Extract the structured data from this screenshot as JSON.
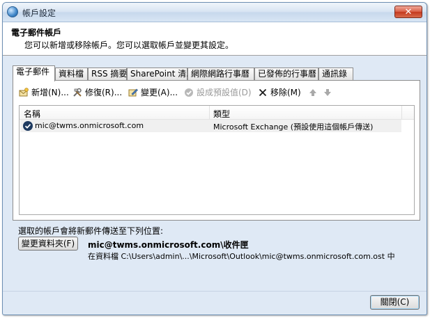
{
  "window": {
    "title": "帳戶設定",
    "close_label": "✕"
  },
  "header": {
    "title": "電子郵件帳戶",
    "description": "您可以新增或移除帳戶。您可以選取帳戶並變更其設定。"
  },
  "tabs": [
    {
      "label": "電子郵件",
      "active": true
    },
    {
      "label": "資料檔",
      "active": false
    },
    {
      "label": "RSS 摘要",
      "active": false
    },
    {
      "label": "SharePoint 清單",
      "active": false
    },
    {
      "label": "網際網路行事曆",
      "active": false
    },
    {
      "label": "已發佈的行事曆",
      "active": false
    },
    {
      "label": "通訊錄",
      "active": false
    }
  ],
  "toolbar": {
    "new_label": "新增(N)...",
    "repair_label": "修復(R)...",
    "change_label": "變更(A)...",
    "set_default_label": "設成預設值(D)",
    "remove_label": "移除(M)",
    "up_icon": "arrow-up-icon",
    "down_icon": "arrow-down-icon"
  },
  "account_list": {
    "columns": [
      "名稱",
      "類型"
    ],
    "rows": [
      {
        "name": "mic@twms.onmicrosoft.com",
        "type": "Microsoft Exchange (預設使用這個帳戶傳送)"
      }
    ]
  },
  "delivery": {
    "label": "選取的帳戶會將新郵件傳送至下列位置:",
    "change_folder_label": "變更資料夾(F)",
    "folder_name": "mic@twms.onmicrosoft.com\\收件匣",
    "folder_path": "在資料檔 C:\\Users\\admin\\...\\Microsoft\\Outlook\\mic@twms.onmicrosoft.com.ost 中"
  },
  "footer": {
    "close_label": "關閉(C)"
  },
  "colors": {
    "titlebar": "#d6e3f2",
    "close_button": "#c4391f",
    "selected_row": "#f0f0f0",
    "disabled_text": "#9a9a9a"
  }
}
